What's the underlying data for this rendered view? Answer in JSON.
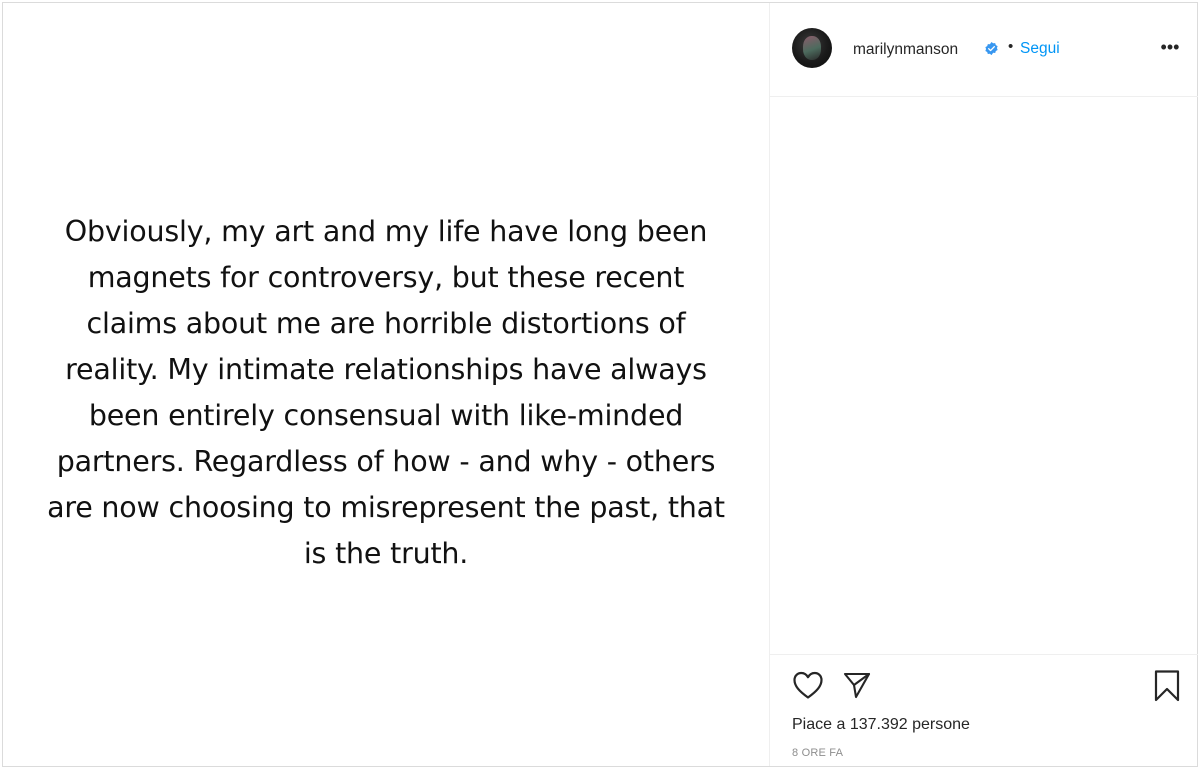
{
  "post": {
    "text": "Obviously, my art and my life have long been magnets for controversy, but these recent claims about me are horrible distortions of reality. My intimate relationships have always been entirely consensual with like-minded partners. Regardless of how - and why - others are now choosing to misrepresent the past, that is the truth.",
    "text_lines": [
      "Obviously, my art and my life have long been",
      "magnets for controversy, but these recent",
      "claims about me are horrible distortions of",
      "reality. My intimate relationships have always",
      "been entirely consensual with like-minded",
      "partners. Regardless of how - and why - others",
      "are now choosing to misrepresent the past, that",
      "is the truth."
    ]
  },
  "header": {
    "username": "marilynmanson",
    "separator": "•",
    "follow_label": "Segui",
    "more_label": "•••"
  },
  "actions": {
    "like_icon": "heart-icon",
    "share_icon": "paper-plane-icon",
    "save_icon": "bookmark-icon"
  },
  "footer": {
    "likes_text": "Piace a 137.392 persone",
    "timestamp": "8 ORE FA"
  },
  "colors": {
    "accent": "#0095f6",
    "verified": "#3897f0",
    "text": "#262626",
    "muted": "#8e8e8e",
    "border": "#dbdbdb"
  }
}
